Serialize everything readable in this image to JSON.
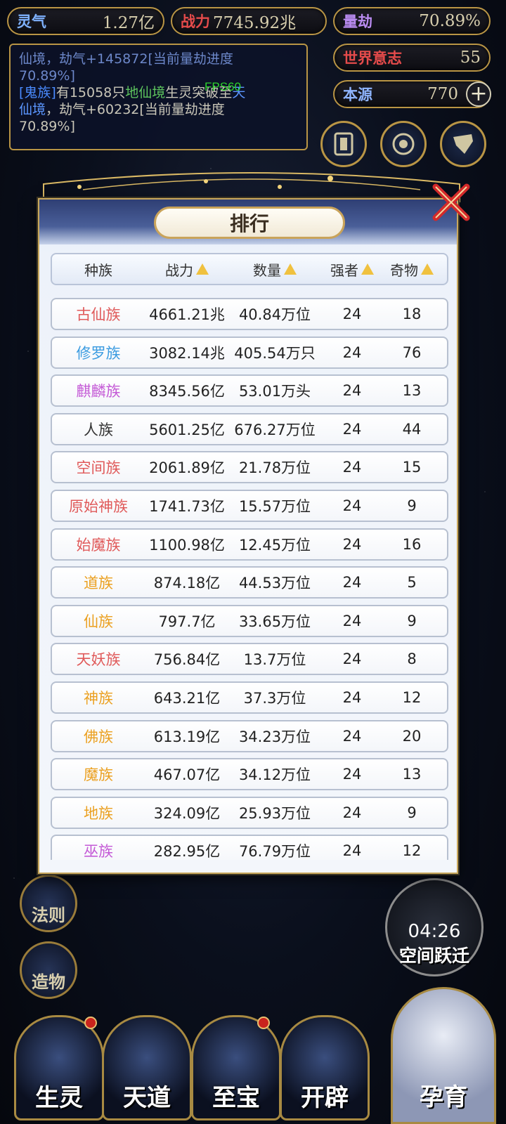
{
  "resources": {
    "lingqi": {
      "label": "灵气",
      "value": "1.27亿"
    },
    "zhanli": {
      "label": "战力",
      "value": "7745.92兆"
    },
    "liangjie": {
      "label": "量劫",
      "value": "70.89%"
    },
    "shijie": {
      "label": "世界意志",
      "value": "55"
    },
    "benyuan": {
      "label": "本源",
      "value": "770"
    }
  },
  "log": {
    "line1": "仙境，劫气+145872[当前量劫进度",
    "line2": "70.89%]",
    "line3_tag": "[鬼族]",
    "line3_a": "有15058只",
    "line3_di": "地仙境",
    "line3_b": "生灵突破至",
    "line3_tian": "天",
    "line4_tian": "仙境",
    "line4_b": "，劫气+60232[当前量劫进度",
    "line5": "70.89%]"
  },
  "fps": "FPS60",
  "side_left": [
    "法则",
    "造物"
  ],
  "timer": {
    "time": "04:26",
    "label": "空间跃迁"
  },
  "bottom_nav": [
    "生灵",
    "天道",
    "至宝",
    "开辟"
  ],
  "yunyu": "孕育",
  "ranking": {
    "title": "排行",
    "headers": [
      "种族",
      "战力",
      "数量",
      "强者",
      "奇物"
    ],
    "rows": [
      {
        "race": "古仙族",
        "color": "#e05a5a",
        "power": "4661.21兆",
        "count": "40.84万位",
        "strong": "24",
        "items": "18"
      },
      {
        "race": "修罗族",
        "color": "#3a9be0",
        "power": "3082.14兆",
        "count": "405.54万只",
        "strong": "24",
        "items": "76"
      },
      {
        "race": "麒麟族",
        "color": "#c45ad6",
        "power": "8345.56亿",
        "count": "53.01万头",
        "strong": "24",
        "items": "13"
      },
      {
        "race": "人族",
        "color": "#333333",
        "power": "5601.25亿",
        "count": "676.27万位",
        "strong": "24",
        "items": "44"
      },
      {
        "race": "空间族",
        "color": "#e05a5a",
        "power": "2061.89亿",
        "count": "21.78万位",
        "strong": "24",
        "items": "15"
      },
      {
        "race": "原始神族",
        "color": "#e05a5a",
        "power": "1741.73亿",
        "count": "15.57万位",
        "strong": "24",
        "items": "9"
      },
      {
        "race": "始魔族",
        "color": "#e05a5a",
        "power": "1100.98亿",
        "count": "12.45万位",
        "strong": "24",
        "items": "16"
      },
      {
        "race": "道族",
        "color": "#eba020",
        "power": "874.18亿",
        "count": "44.53万位",
        "strong": "24",
        "items": "5"
      },
      {
        "race": "仙族",
        "color": "#eba020",
        "power": "797.7亿",
        "count": "33.65万位",
        "strong": "24",
        "items": "9"
      },
      {
        "race": "天妖族",
        "color": "#e05a5a",
        "power": "756.84亿",
        "count": "13.7万位",
        "strong": "24",
        "items": "8"
      },
      {
        "race": "神族",
        "color": "#eba020",
        "power": "643.21亿",
        "count": "37.3万位",
        "strong": "24",
        "items": "12"
      },
      {
        "race": "佛族",
        "color": "#eba020",
        "power": "613.19亿",
        "count": "34.23万位",
        "strong": "24",
        "items": "20"
      },
      {
        "race": "魔族",
        "color": "#eba020",
        "power": "467.07亿",
        "count": "34.12万位",
        "strong": "24",
        "items": "13"
      },
      {
        "race": "地族",
        "color": "#eba020",
        "power": "324.09亿",
        "count": "25.93万位",
        "strong": "24",
        "items": "9"
      },
      {
        "race": "巫族",
        "color": "#c45ad6",
        "power": "282.95亿",
        "count": "76.79万位",
        "strong": "24",
        "items": "12"
      }
    ]
  }
}
